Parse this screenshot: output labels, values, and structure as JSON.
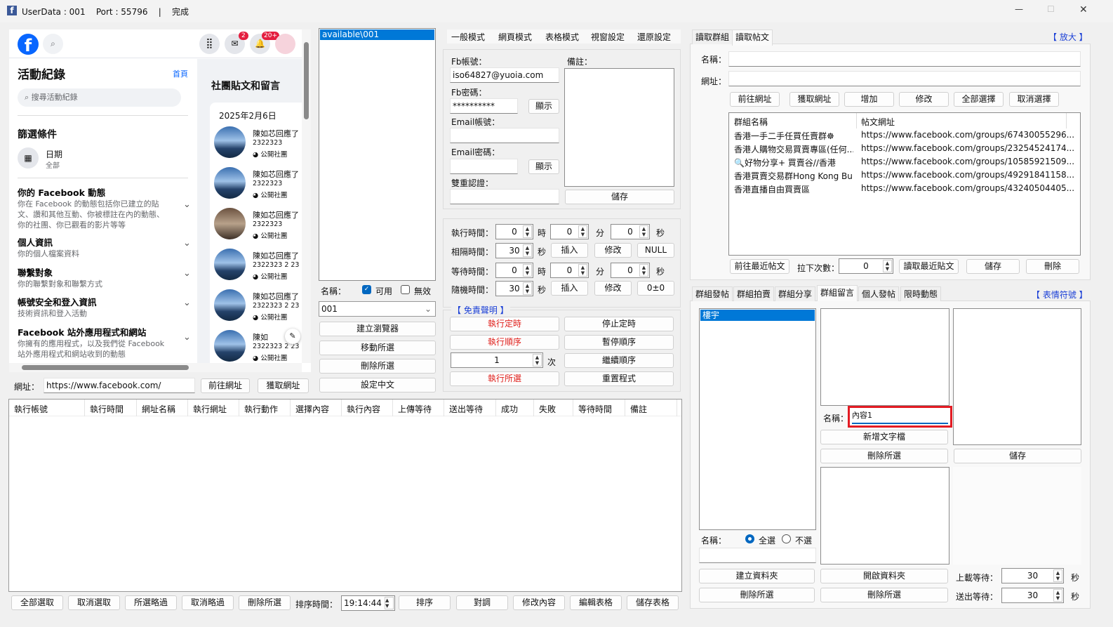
{
  "window": {
    "title": "UserData : 001    Port : 55796    |    完成",
    "controls": [
      "—",
      "☐",
      "✕"
    ]
  },
  "fb": {
    "badge_messenger": "2",
    "badge_notif": "20+",
    "activity_title": "活動紀錄",
    "home_link": "首頁",
    "search_placeholder": "搜尋活動紀錄",
    "filter_title": "篩選條件",
    "date_label": "日期",
    "date_value": "全部",
    "sections": [
      {
        "title": "你的 Facebook 動態",
        "desc": "你在 Facebook 的動態包括你已建立的貼文、讚和其他互動、你被標註在內的動態、你的社團、你已觀看的影片等等"
      },
      {
        "title": "個人資訊",
        "desc": "你的個人檔案資料"
      },
      {
        "title": "聯繫對象",
        "desc": "你的聯繫對象和聯繫方式"
      },
      {
        "title": "帳號安全和登入資訊",
        "desc": "技術資訊和登入活動"
      },
      {
        "title": "Facebook 站外應用程式和網站",
        "desc": "你擁有的應用程式，以及我們從 Facebook 站外應用程式和網站收到的動態"
      }
    ],
    "right_title": "社團貼文和留言",
    "date": "2025年2月6日",
    "posts": [
      {
        "name": "陳如芯回應了",
        ". ": "",
        "content": "2322323",
        "group": "公開社團"
      },
      {
        "name": "陳如芯回應了",
        "content": "2322323",
        "group": "公開社團"
      },
      {
        "name": "陳如芯回應了",
        "content": "2322323",
        "group": "公開社團"
      },
      {
        "name": "陳如芯回應了",
        "content": "2322323 2 23",
        "group": "公開社團"
      },
      {
        "name": "陳如芯回應了",
        "content": "2322323 2 23",
        "group": "公開社團"
      },
      {
        "name": "陳如",
        "content": "2322323 2 23",
        "group": "公開社團"
      }
    ]
  },
  "url_bar": {
    "label": "網址：",
    "value": "https://www.facebook.com/",
    "go": "前往網址",
    "get": "獲取網址"
  },
  "profiles": {
    "items": [
      "available\\001"
    ],
    "name_label": "名稱：",
    "enabled": "可用",
    "disabled": "無效",
    "combo": "001",
    "buttons": [
      "建立瀏覽器",
      "移動所選",
      "刪除所選",
      "設定中文"
    ]
  },
  "menu": [
    "一般模式",
    "網頁模式",
    "表格模式",
    "視窗設定",
    "還原設定"
  ],
  "account": {
    "fb_account_label": "Fb帳號：",
    "fb_account": "iso64827@yuoia.com",
    "fb_pw_label": "Fb密碼：",
    "fb_pw": "**********",
    "show": "顯示",
    "email_label": "Email帳號：",
    "email_pw_label": "Email密碼：",
    "twofa_label": "雙重認證：",
    "note_label": "備註：",
    "save": "儲存"
  },
  "timing": {
    "exec_label": "執行時間：",
    "interval_label": "相隔時間：",
    "wait_label": "等待時間：",
    "random_label": "隨機時間：",
    "h": "時",
    "m": "分",
    "s": "秒",
    "exec": [
      "0",
      "0",
      "0"
    ],
    "interval": "30",
    "wait": [
      "0",
      "0",
      "0"
    ],
    "random": "30",
    "insert": "插入",
    "modify": "修改",
    "null": "NULL",
    "pm": "0±0"
  },
  "control": {
    "disclaimer": "【 免責聲明 】",
    "run_timer": "執行定時",
    "stop_timer": "停止定時",
    "run_seq": "執行順序",
    "pause_seq": "暫停順序",
    "count": "1",
    "times": "次",
    "continue_seq": "繼續順序",
    "run_sel": "執行所選",
    "reset": "重置程式"
  },
  "log_table": {
    "headers": [
      "執行帳號",
      "執行時間",
      "網址名稱",
      "執行網址",
      "執行動作",
      "選擇內容",
      "執行內容",
      "上傳等待",
      "送出等待",
      "成功",
      "失敗",
      "等待時間",
      "備註"
    ]
  },
  "bottom": {
    "buttons1": [
      "全部選取",
      "取消選取",
      "所選略過",
      "取消略過",
      "刪除所選"
    ],
    "sort_label": "排序時間：",
    "sort_time": "19:14:44",
    "buttons2": [
      "排序",
      "對調",
      "修改內容",
      "編輯表格",
      "儲存表格"
    ]
  },
  "read": {
    "tabs": [
      "讀取群組",
      "讀取帖文"
    ],
    "zoom": "【 放大 】",
    "name_label": "名稱：",
    "url_label": "網址：",
    "buttons": [
      "前往網址",
      "獲取網址",
      "增加",
      "修改",
      "全部選擇",
      "取消選擇"
    ],
    "headers": [
      "群組名稱",
      "帖文網址"
    ],
    "rows": [
      [
        "香港一手二手任買任賣群☸",
        "https://www.facebook.com/groups/67430055296..."
      ],
      [
        "香港人購物交易買賣專區(任何...",
        "https://www.facebook.com/groups/23254524174..."
      ],
      [
        "🔍好物分享+ 買賣谷//香港",
        "https://www.facebook.com/groups/10585921509..."
      ],
      [
        "香港買賣交易群Hong Kong Bu...",
        "https://www.facebook.com/groups/49291841158..."
      ],
      [
        "香港直播自由買賣區",
        "https://www.facebook.com/groups/43240504405..."
      ]
    ],
    "recent": "前往最近帖文",
    "pull_label": "拉下次數：",
    "pull": "0",
    "read_recent": "讀取最近貼文",
    "save": "儲存",
    "delete": "刪除"
  },
  "post": {
    "tabs": [
      "群組發帖",
      "群組拍賣",
      "群組分享",
      "群組留言",
      "個人發帖",
      "限時動態"
    ],
    "emoji": "【 表情符號 】",
    "list": [
      "樓宇"
    ],
    "name_label": "名稱：",
    "content_name": "內容1",
    "add_text": "新增文字檔",
    "del_sel": "刪除所選",
    "save": "儲存",
    "all": "全選",
    "none": "不選",
    "mkdir": "建立資料夾",
    "opendir": "開啟資料夾",
    "upload_label": "上載等待：",
    "upload": "30",
    "send_label": "送出等待：",
    "send": "30",
    "sec": "秒"
  }
}
